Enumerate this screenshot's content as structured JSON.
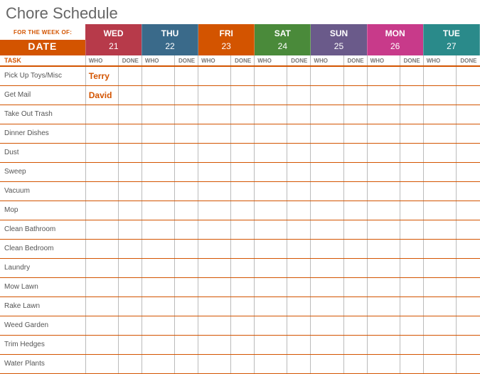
{
  "title": "Chore Schedule",
  "week_label": "FOR THE WEEK OF:",
  "date_label": "DATE",
  "task_label": "TASK",
  "who_label": "WHO",
  "done_label": "DONE",
  "days": [
    {
      "name": "WED",
      "num": "21",
      "bg": "#b73a4a"
    },
    {
      "name": "THU",
      "num": "22",
      "bg": "#3a6a8a"
    },
    {
      "name": "FRI",
      "num": "23",
      "bg": "#d35400"
    },
    {
      "name": "SAT",
      "num": "24",
      "bg": "#4a8a3a"
    },
    {
      "name": "SUN",
      "num": "25",
      "bg": "#6a5a8a"
    },
    {
      "name": "MON",
      "num": "26",
      "bg": "#c83a8a"
    },
    {
      "name": "TUE",
      "num": "27",
      "bg": "#2a8a8a"
    }
  ],
  "date_bg": "#d35400",
  "tasks": [
    "Pick Up Toys/Misc",
    "Get Mail",
    "Take Out Trash",
    "Dinner Dishes",
    "Dust",
    "Sweep",
    "Vacuum",
    "Mop",
    "Clean Bathroom",
    "Clean Bedroom",
    "Laundry",
    "Mow Lawn",
    "Rake Lawn",
    "Weed Garden",
    "Trim Hedges",
    "Water Plants"
  ],
  "assignments": {
    "0": {
      "0": "Terry"
    },
    "1": {
      "0": "David"
    }
  }
}
